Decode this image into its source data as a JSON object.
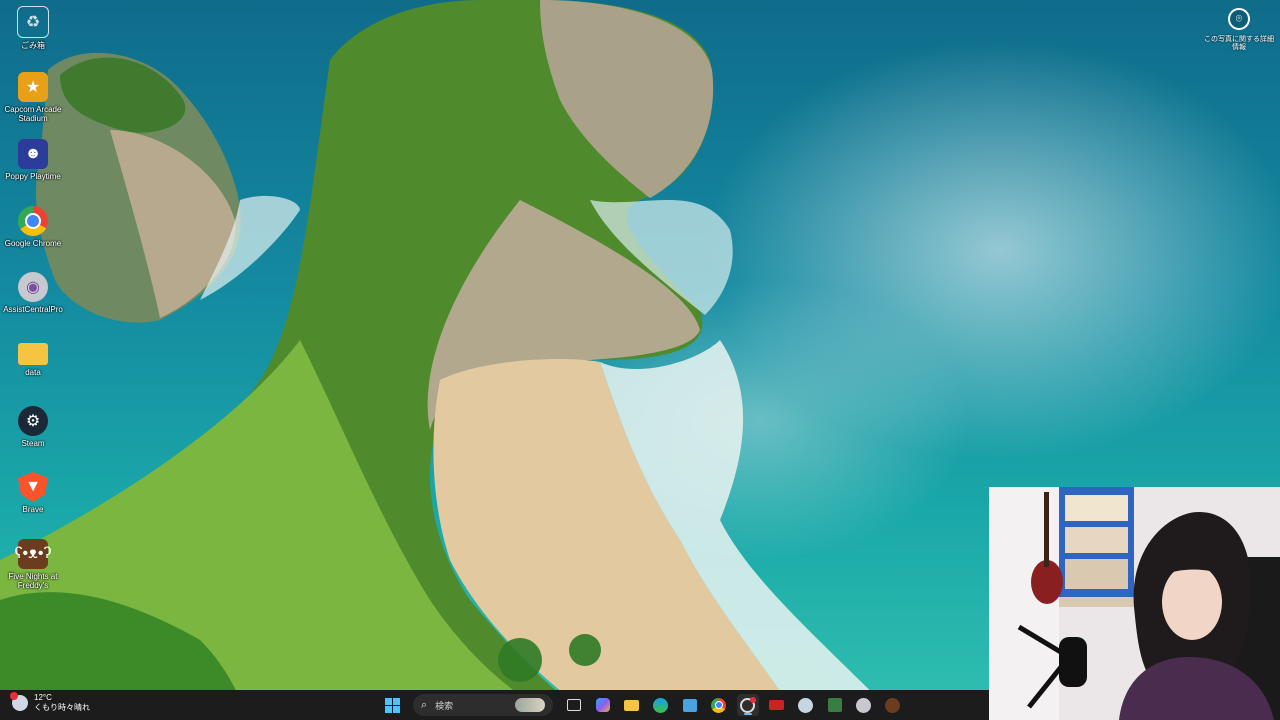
{
  "desktop": {
    "icons": [
      {
        "label": "ごみ箱",
        "icon": "recycle-bin-icon",
        "color": "#8fb3cc"
      },
      {
        "label": "Capcom Arcade Stadium",
        "icon": "capcom-arcade-icon",
        "color": "#e8a017"
      },
      {
        "label": "Poppy Playtime",
        "icon": "poppy-playtime-icon",
        "color": "#2b3c9a"
      },
      {
        "label": "Google Chrome",
        "icon": "chrome-icon",
        "color": "#4285f4"
      },
      {
        "label": "AssistCentralPro",
        "icon": "assistcentral-icon",
        "color": "#c8c8d0"
      },
      {
        "label": "data",
        "icon": "folder-icon",
        "color": "#f5c542"
      },
      {
        "label": "Steam",
        "icon": "steam-icon",
        "color": "#1b2838"
      },
      {
        "label": "Brave",
        "icon": "brave-icon",
        "color": "#fb542b"
      },
      {
        "label": "Five Nights at Freddy's",
        "icon": "fnaf-icon",
        "color": "#6b3d1e"
      }
    ]
  },
  "spotlight": {
    "label": "この写真に関する詳細情報"
  },
  "taskbar": {
    "weather": {
      "temp": "12°C",
      "condition": "くもり時々晴れ"
    },
    "search_placeholder": "検索",
    "apps": [
      {
        "name": "task-view-icon",
        "color": "#3a3a3a"
      },
      {
        "name": "copilot-icon",
        "color": "#8a5cf6"
      },
      {
        "name": "file-explorer-icon",
        "color": "#f5c542"
      },
      {
        "name": "edge-icon",
        "color": "#1ba1e2"
      },
      {
        "name": "microsoft-store-icon",
        "color": "#4aa3df"
      },
      {
        "name": "chrome-taskbar-icon",
        "color": "#4285f4"
      },
      {
        "name": "obs-icon",
        "color": "#2a2a2a"
      },
      {
        "name": "app-red-icon",
        "color": "#c22"
      },
      {
        "name": "steam-taskbar-icon",
        "color": "#1b2838"
      },
      {
        "name": "app-green-icon",
        "color": "#3a7d44"
      },
      {
        "name": "assistcentral-taskbar-icon",
        "color": "#c8c8d0"
      },
      {
        "name": "fnaf-taskbar-icon",
        "color": "#6b3d1e"
      }
    ]
  }
}
